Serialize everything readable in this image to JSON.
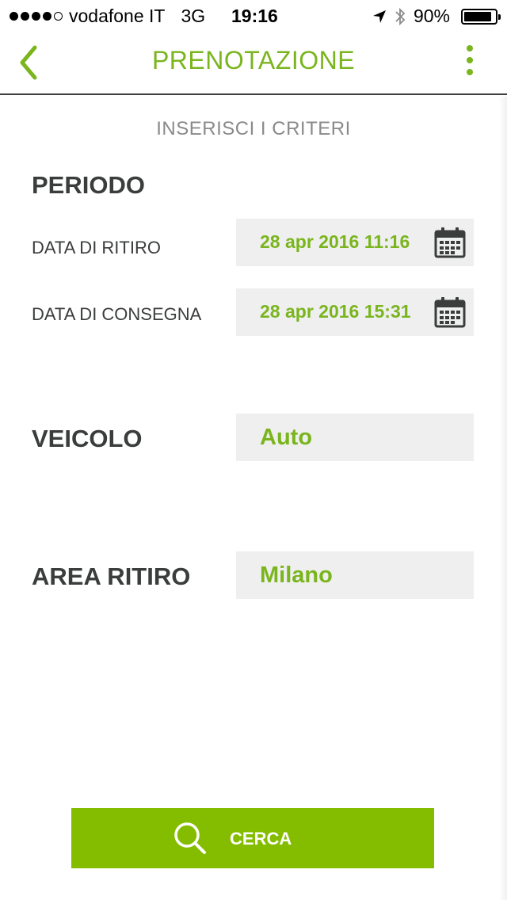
{
  "status_bar": {
    "carrier": "vodafone IT",
    "network": "3G",
    "time": "19:16",
    "battery_percent": "90%",
    "battery_level": 0.9,
    "signal_dots_filled": 4,
    "signal_dots_total": 5
  },
  "nav": {
    "title": "PRENOTAZIONE",
    "accent_color": "#7ab51d"
  },
  "subtitle": "INSERISCI I CRITERI",
  "periodo": {
    "heading": "PERIODO",
    "pickup": {
      "label": "DATA DI RITIRO",
      "value": "28 apr 2016 11:16",
      "icon": "calendar-icon"
    },
    "delivery": {
      "label": "DATA DI CONSEGNA",
      "value": "28 apr 2016 15:31",
      "icon": "calendar-icon"
    }
  },
  "veicolo": {
    "heading": "VEICOLO",
    "value": "Auto"
  },
  "area": {
    "heading": "AREA RITIRO",
    "value": "Milano"
  },
  "search_button": {
    "label": "CERCA",
    "icon": "search-icon",
    "color": "#84bd00"
  }
}
